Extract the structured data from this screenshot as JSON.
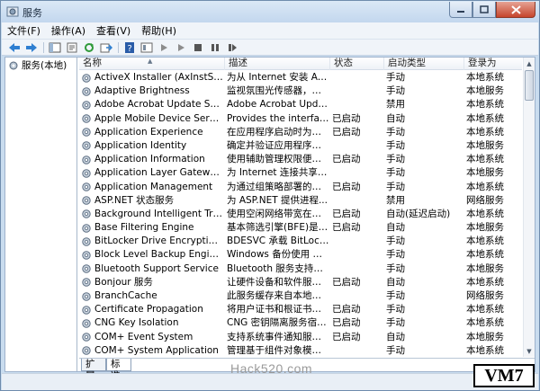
{
  "window": {
    "title": "服务",
    "buttons": [
      "minimize",
      "maximize",
      "close"
    ]
  },
  "menu": [
    "文件(F)",
    "操作(A)",
    "查看(V)",
    "帮助(H)"
  ],
  "toolbar": [
    "back-arrow-icon",
    "forward-arrow-icon",
    "console-tree-icon",
    "properties-icon",
    "refresh-icon",
    "export-icon",
    "help-icon",
    "view-icon",
    "play-icon",
    "play-alt-icon",
    "stop-icon",
    "pause-icon",
    "restart-icon"
  ],
  "tree": {
    "label": "服务(本地)"
  },
  "columns": {
    "name": "名称",
    "desc": "描述",
    "status": "状态",
    "start": "启动类型",
    "logon": "登录为"
  },
  "services": [
    {
      "name": "ActiveX Installer (AxInstSV)",
      "desc": "为从 Internet 安装 Acti...",
      "status": "",
      "start": "手动",
      "logon": "本地系统"
    },
    {
      "name": "Adaptive Brightness",
      "desc": "监视氛围光传感器，以...",
      "status": "",
      "start": "手动",
      "logon": "本地服务"
    },
    {
      "name": "Adobe Acrobat Update Service",
      "desc": "Adobe Acrobat Upda...",
      "status": "",
      "start": "禁用",
      "logon": "本地系统"
    },
    {
      "name": "Apple Mobile Device Service",
      "desc": "Provides the interface...",
      "status": "已启动",
      "start": "自动",
      "logon": "本地系统"
    },
    {
      "name": "Application Experience",
      "desc": "在应用程序启动时为应...",
      "status": "已启动",
      "start": "手动",
      "logon": "本地系统"
    },
    {
      "name": "Application Identity",
      "desc": "确定并验证应用程序的...",
      "status": "",
      "start": "手动",
      "logon": "本地服务"
    },
    {
      "name": "Application Information",
      "desc": "使用辅助管理权限便于...",
      "status": "已启动",
      "start": "手动",
      "logon": "本地系统"
    },
    {
      "name": "Application Layer Gateway Se...",
      "desc": "为 Internet 连接共享提...",
      "status": "",
      "start": "手动",
      "logon": "本地服务"
    },
    {
      "name": "Application Management",
      "desc": "为通过组策略部署的软...",
      "status": "已启动",
      "start": "手动",
      "logon": "本地系统"
    },
    {
      "name": "ASP.NET 状态服务",
      "desc": "为 ASP.NET 提供进程...",
      "status": "",
      "start": "禁用",
      "logon": "网络服务"
    },
    {
      "name": "Background Intelligent Transf...",
      "desc": "使用空闲网络带宽在后...",
      "status": "已启动",
      "start": "自动(延迟启动)",
      "logon": "本地系统"
    },
    {
      "name": "Base Filtering Engine",
      "desc": "基本筛选引擎(BFE)是一...",
      "status": "已启动",
      "start": "自动",
      "logon": "本地服务"
    },
    {
      "name": "BitLocker Drive Encryption Se...",
      "desc": "BDESVC 承载 BitLocke...",
      "status": "",
      "start": "手动",
      "logon": "本地系统"
    },
    {
      "name": "Block Level Backup Engine Ser...",
      "desc": "Windows 备份使用 WB...",
      "status": "",
      "start": "手动",
      "logon": "本地系统"
    },
    {
      "name": "Bluetooth Support Service",
      "desc": "Bluetooth 服务支持发...",
      "status": "",
      "start": "手动",
      "logon": "本地服务"
    },
    {
      "name": "Bonjour 服务",
      "desc": "让硬件设备和软件服务...",
      "status": "已启动",
      "start": "自动",
      "logon": "本地系统"
    },
    {
      "name": "BranchCache",
      "desc": "此服务缓存来自本地子...",
      "status": "",
      "start": "手动",
      "logon": "网络服务"
    },
    {
      "name": "Certificate Propagation",
      "desc": "将用户证书和根证书从...",
      "status": "已启动",
      "start": "手动",
      "logon": "本地系统"
    },
    {
      "name": "CNG Key Isolation",
      "desc": "CNG 密钥隔离服务宿主...",
      "status": "已启动",
      "start": "手动",
      "logon": "本地系统"
    },
    {
      "name": "COM+ Event System",
      "desc": "支持系统事件通知服务 ...",
      "status": "已启动",
      "start": "自动",
      "logon": "本地服务"
    },
    {
      "name": "COM+ System Application",
      "desc": "管理基于组件对象模型 (...",
      "status": "",
      "start": "手动",
      "logon": "本地系统"
    }
  ],
  "tabs": {
    "extended": "扩展",
    "standard": "标准"
  },
  "watermark": "Hack520.com",
  "badge": "VM7"
}
